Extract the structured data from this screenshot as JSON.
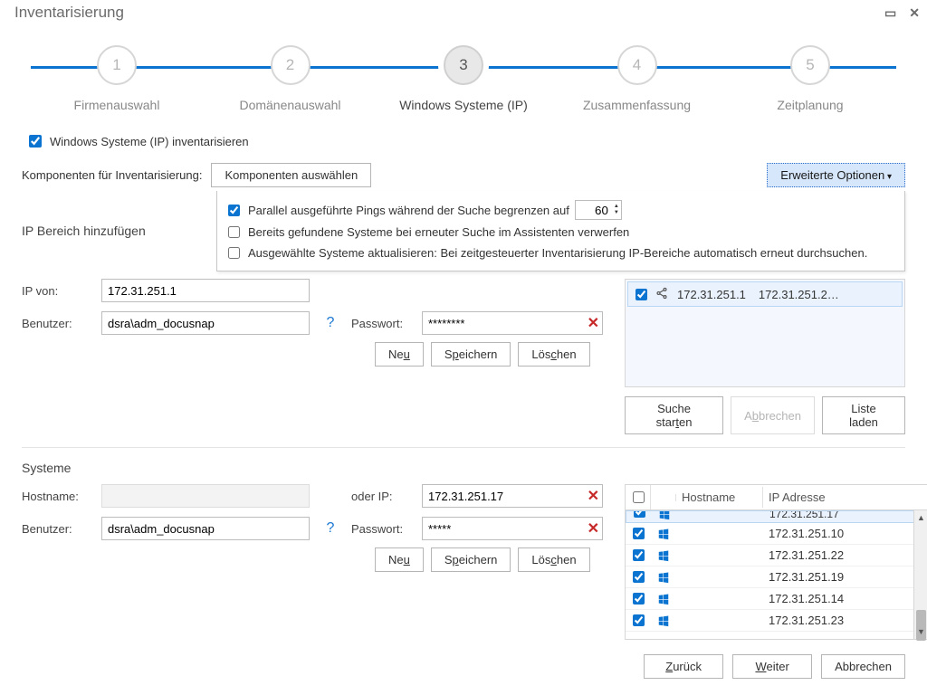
{
  "window": {
    "title": "Inventarisierung"
  },
  "stepper": {
    "steps": [
      {
        "num": "1",
        "label": "Firmenauswahl"
      },
      {
        "num": "2",
        "label": "Domänenauswahl"
      },
      {
        "num": "3",
        "label": "Windows Systeme (IP)"
      },
      {
        "num": "4",
        "label": "Zusammenfassung"
      },
      {
        "num": "5",
        "label": "Zeitplanung"
      }
    ],
    "activeIndex": 2
  },
  "topCheckbox": {
    "label": "Windows Systeme (IP) inventarisieren",
    "checked": true
  },
  "components": {
    "label": "Komponenten für Inventarisierung:",
    "button": "Komponenten auswählen",
    "advanced": "Erweiterte Optionen"
  },
  "advancedOptions": {
    "pingLimit": {
      "label": "Parallel ausgeführte Pings während der Suche begrenzen auf",
      "checked": true,
      "value": "60"
    },
    "discardFound": {
      "label": "Bereits gefundene Systeme bei erneuter Suche im Assistenten verwerfen",
      "checked": false
    },
    "refreshSelected": {
      "label": "Ausgewählte Systeme aktualisieren: Bei zeitgesteuerter Inventarisierung IP-Bereiche automatisch erneut durchsuchen.",
      "checked": false
    }
  },
  "ipRange": {
    "sectionLabel": "IP Bereich hinzufügen",
    "ipFromLabel": "IP von:",
    "ipFrom": "172.31.251.1",
    "userLabel": "Benutzer:",
    "user": "dsra\\adm_docusnap",
    "pwdLabel": "Passwort:",
    "pwd": "********",
    "buttons": {
      "new": "Neu",
      "save": "Speichern",
      "delete": "Löschen"
    },
    "ranges": [
      {
        "from": "172.31.251.1",
        "to": "172.31.251.2…",
        "checked": true
      }
    ],
    "searchButtons": {
      "start": "Suche starten",
      "cancel": "Abbrechen",
      "loadList": "Liste laden"
    }
  },
  "systems": {
    "sectionLabel": "Systeme",
    "hostLabel": "Hostname:",
    "orIpLabel": "oder IP:",
    "orIp": "172.31.251.17",
    "userLabel": "Benutzer:",
    "user": "dsra\\adm_docusnap",
    "pwdLabel": "Passwort:",
    "pwd": "*****",
    "buttons": {
      "new": "Neu",
      "save": "Speichern",
      "delete": "Löschen"
    },
    "columns": {
      "hostname": "Hostname",
      "ip": "IP Adresse"
    },
    "rows": [
      {
        "hostname": "",
        "ip": "172.31.251.17",
        "checked": true,
        "partial": true
      },
      {
        "hostname": "",
        "ip": "172.31.251.10",
        "checked": true
      },
      {
        "hostname": "",
        "ip": "172.31.251.22",
        "checked": true
      },
      {
        "hostname": "",
        "ip": "172.31.251.19",
        "checked": true
      },
      {
        "hostname": "",
        "ip": "172.31.251.14",
        "checked": true
      },
      {
        "hostname": "",
        "ip": "172.31.251.23",
        "checked": true
      }
    ]
  },
  "footer": {
    "back": "Zurück",
    "next": "Weiter",
    "cancel": "Abbrechen"
  },
  "hotkeys": {
    "new_u": "u",
    "save_p": "p",
    "delete_c": "c",
    "start_t": "t",
    "cancel_b": "b",
    "back_Z": "Z",
    "next_W": "W"
  }
}
